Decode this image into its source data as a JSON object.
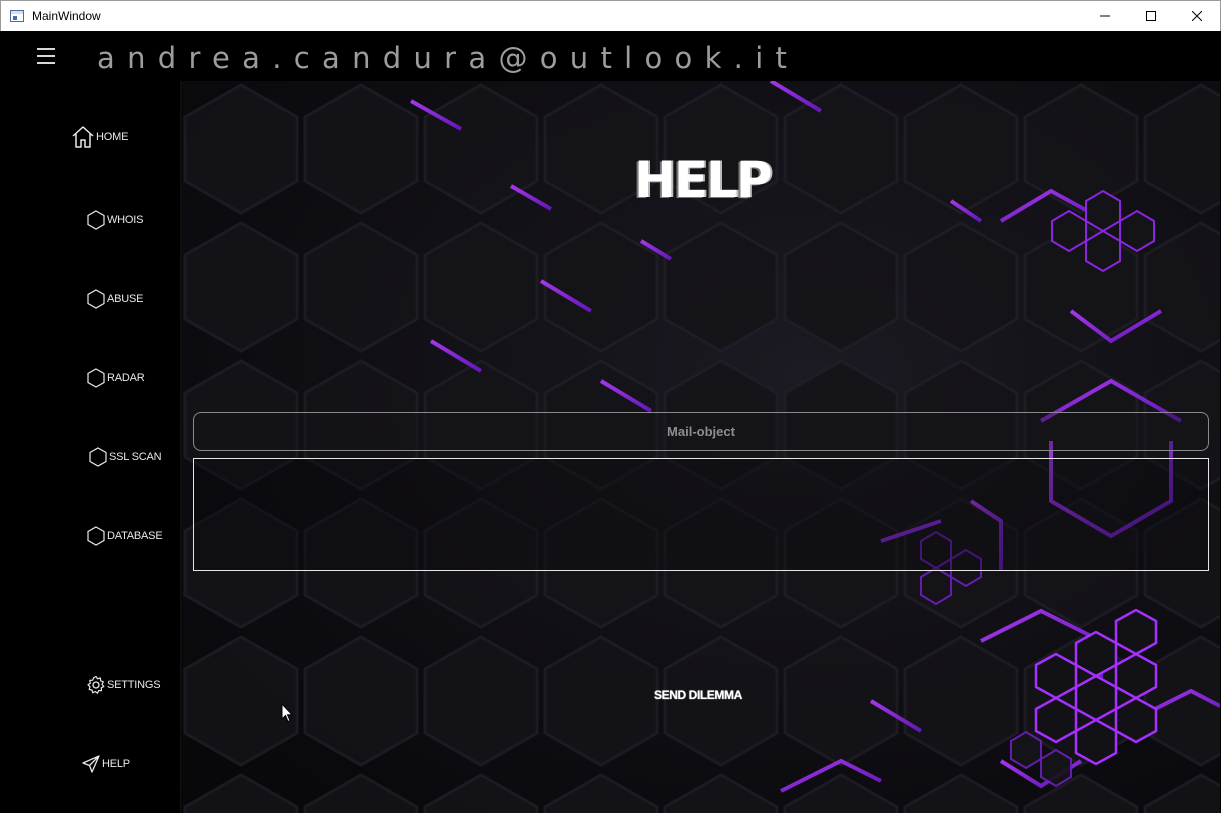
{
  "window": {
    "title": "MainWindow"
  },
  "header": {
    "email": "andrea.candura@outlook.it"
  },
  "sidebar": {
    "items": [
      {
        "label": "HOME",
        "icon": "home-icon"
      },
      {
        "label": "WHOIS",
        "icon": "hexagon-icon"
      },
      {
        "label": "ABUSE",
        "icon": "hexagon-icon"
      },
      {
        "label": "RADAR",
        "icon": "hexagon-icon"
      },
      {
        "label": "SSL SCAN",
        "icon": "hexagon-icon"
      },
      {
        "label": "DATABASE",
        "icon": "hexagon-icon"
      },
      {
        "label": "SETTINGS",
        "icon": "gear-icon"
      },
      {
        "label": "HELP",
        "icon": "send-icon"
      }
    ]
  },
  "main": {
    "title": "HELP",
    "mail_object_placeholder": "Mail-object",
    "mail_body_value": "",
    "send_label": "SEND DILEMMA"
  },
  "colors": {
    "accent": "#9b2cf0",
    "background": "#000000",
    "text": "#ffffff"
  }
}
